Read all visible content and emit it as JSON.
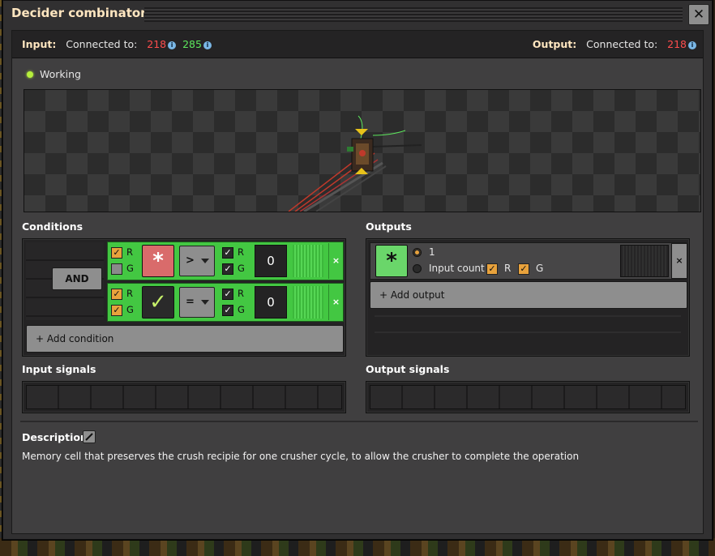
{
  "window": {
    "title": "Decider combinator",
    "close_label": "✕"
  },
  "connections": {
    "input_label": "Input:",
    "input_connected_label": "Connected to:",
    "input_red": "218",
    "input_green": "285",
    "output_label": "Output:",
    "output_connected_label": "Connected to:",
    "output_red": "218"
  },
  "status": {
    "text": "Working",
    "color": "#b6ef3c"
  },
  "conditions": {
    "title": "Conditions",
    "and_label": "AND",
    "rows": [
      {
        "left_r_checked": true,
        "left_g_checked": false,
        "r_label": "R",
        "g_label": "G",
        "signal_icon": "everything-icon",
        "signal_glyph": "*",
        "comparator": ">",
        "right_r_label": "R",
        "right_g_label": "G",
        "constant": "0",
        "remove_label": "×"
      },
      {
        "left_r_checked": true,
        "left_g_checked": true,
        "r_label": "R",
        "g_label": "G",
        "signal_icon": "check-icon",
        "signal_glyph": "✓",
        "comparator": "=",
        "right_r_label": "R",
        "right_g_label": "G",
        "constant": "0",
        "remove_label": "×"
      }
    ],
    "add_label": "+ Add condition"
  },
  "outputs": {
    "title": "Outputs",
    "signal_icon": "everything-icon",
    "signal_glyph": "*",
    "option_constant": "1",
    "option_input_count": "Input count",
    "r_label": "R",
    "g_label": "G",
    "remove_label": "×",
    "add_label": "+ Add output"
  },
  "input_signals": {
    "title": "Input signals"
  },
  "output_signals": {
    "title": "Output signals"
  },
  "description": {
    "title": "Description",
    "text": "Memory cell that preserves the crush recipie for one crusher cycle, to allow the crusher to complete the operation"
  },
  "colors": {
    "condition_green": "#43c742",
    "checkbox_orange": "#e8a23c",
    "signal_red": "#ff4d4d",
    "signal_green": "#5de85d",
    "window_bg": "#313031"
  }
}
